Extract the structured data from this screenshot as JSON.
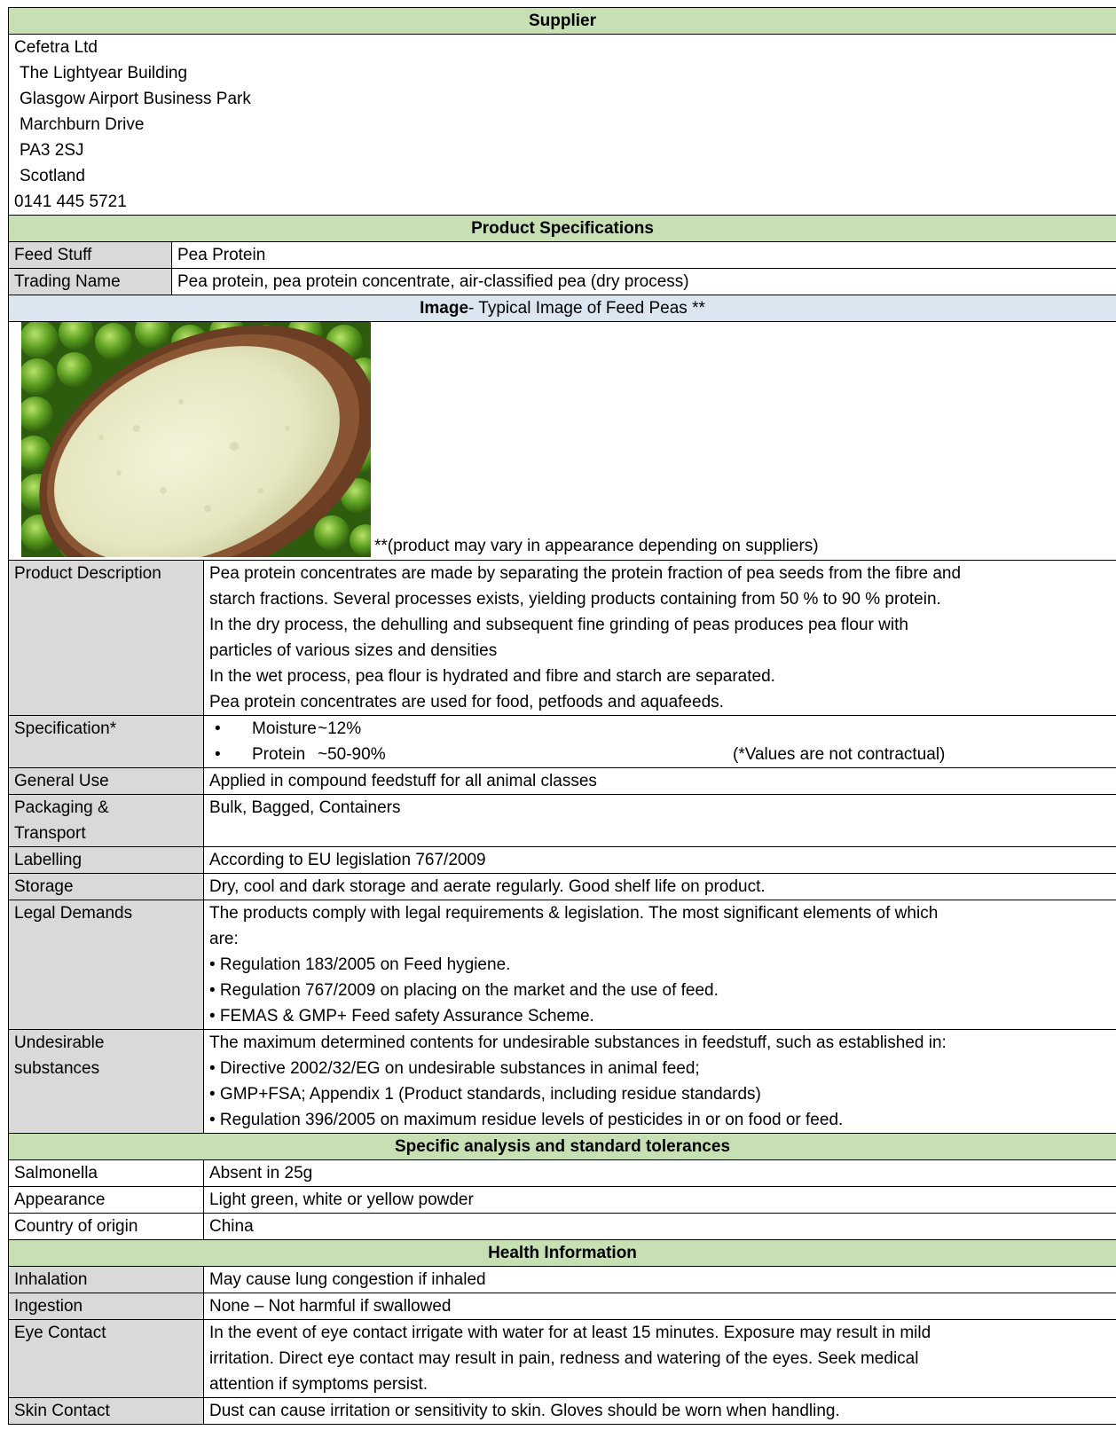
{
  "supplier": {
    "header": "Supplier",
    "lines": [
      "Cefetra Ltd",
      "The Lightyear Building",
      "Glasgow Airport Business Park",
      "Marchburn Drive",
      "PA3 2SJ",
      "Scotland",
      "0141 445 5721"
    ]
  },
  "product_specs": {
    "header": "Product Specifications",
    "feed_stuff_label": "Feed Stuff",
    "feed_stuff_value": "Pea Protein",
    "trading_name_label": "Trading Name",
    "trading_name_value": "Pea protein, pea protein concentrate, air-classified pea (dry process)"
  },
  "image_section": {
    "header_bold": "Image",
    "header_rest": "- Typical Image of Feed Peas **",
    "caption": "**(product may vary in appearance depending on suppliers)",
    "photo_icon": "pea-protein-photo"
  },
  "rows": {
    "description_label": "Product Description",
    "description_lines": [
      "Pea protein concentrates are made by separating the protein fraction of pea seeds from the fibre and",
      "starch fractions. Several processes exists, yielding products containing from 50 % to 90 % protein.",
      "In the dry process, the dehulling and subsequent fine grinding of peas produces pea flour with",
      "particles of various sizes and densities",
      "In the wet process, pea flour is hydrated and fibre and starch are separated.",
      "Pea protein concentrates are used for food, petfoods and aquafeeds."
    ],
    "spec_label": "Specification*",
    "spec_items": [
      {
        "bullet": "•",
        "name": "Moisture",
        "value": "~12%"
      },
      {
        "bullet": "•",
        "name": "Protein",
        "value": "~50-90%"
      }
    ],
    "spec_note": "(*Values are not contractual)",
    "general_use_label": "General Use",
    "general_use_value": "Applied in compound feedstuff for all animal classes",
    "packaging_label_lines": [
      "Packaging &",
      "Transport"
    ],
    "packaging_value": "Bulk, Bagged, Containers",
    "labelling_label": "Labelling",
    "labelling_value": "According to EU legislation 767/2009",
    "storage_label": "Storage",
    "storage_value": "Dry, cool and dark storage and aerate regularly. Good shelf life on product.",
    "legal_label": "Legal Demands",
    "legal_lines": [
      "The products comply with legal requirements & legislation.  The most significant elements of which",
      "are:",
      "• Regulation 183/2005 on Feed hygiene.",
      "• Regulation 767/2009 on placing on the market and the use of feed.",
      "• FEMAS & GMP+ Feed safety Assurance Scheme."
    ],
    "undesirable_label_lines": [
      "Undesirable",
      "substances"
    ],
    "undesirable_lines": [
      "The maximum determined contents for undesirable substances in feedstuff, such as established in:",
      "• Directive 2002/32/EG on undesirable substances in animal feed;",
      "• GMP+FSA; Appendix 1 (Product standards, including residue standards)",
      "• Regulation 396/2005 on maximum residue levels of pesticides in or on food or feed."
    ]
  },
  "analysis": {
    "header": "Specific analysis and standard tolerances",
    "items": [
      {
        "label": "Salmonella",
        "value": "Absent in 25g"
      },
      {
        "label": "Appearance",
        "value": "Light green, white or yellow powder"
      },
      {
        "label": "Country of origin",
        "value": "China"
      }
    ]
  },
  "health": {
    "header": "Health Information",
    "inhalation_label": "Inhalation",
    "inhalation_value": "May cause lung congestion if inhaled",
    "ingestion_label": "Ingestion",
    "ingestion_value": "None – Not harmful if swallowed",
    "eye_label": "Eye Contact",
    "eye_lines": [
      "In the event of eye contact irrigate with water for at least 15 minutes.  Exposure may result in mild",
      "irritation. Direct eye contact may result in pain, redness and watering of the eyes.  Seek medical",
      "attention if symptoms persist."
    ],
    "skin_label": "Skin Contact",
    "skin_value": "Dust can cause irritation or sensitivity to skin. Gloves should be worn when handling."
  }
}
